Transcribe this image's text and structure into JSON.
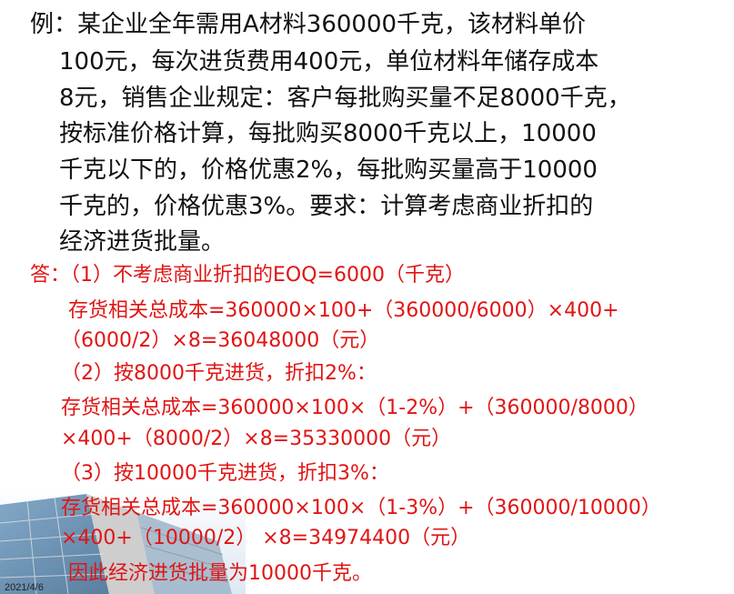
{
  "question": {
    "lines": [
      "例：某企业全年需用A材料360000千克，该材料单价",
      "100元，每次进货费用400元，单位材料年储存成本",
      "8元，销售企业规定：客户每批购买量不足8000千克，",
      "按标准价格计算，每批购买8000千克以上，10000",
      "千克以下的，价格优惠2%，每批购买量高于10000",
      "千克的，价格优惠3%。要求：计算考虑商业折扣的",
      "经济进货批量。"
    ]
  },
  "answer": {
    "lines": [
      "答：（1）不考虑商业折扣的EOQ=6000（千克）",
      "存货相关总成本=360000×100+（360000/6000）×400+",
      "（6000/2）×8=36048000（元）",
      "（2）按8000千克进货，折扣2%：",
      "存货相关总成本=360000×100×（1-2%）+（360000/8000）",
      "×400+（8000/2）×8=35330000（元）",
      "（3）按10000千克进货，折扣3%：",
      "存货相关总成本=360000×100×（1-3%）+（360000/10000）",
      "×400+（10000/2） ×8=34974400（元）",
      "因此经济进货批量为10000千克。"
    ]
  },
  "footer": {
    "date": "2021/4/6"
  }
}
